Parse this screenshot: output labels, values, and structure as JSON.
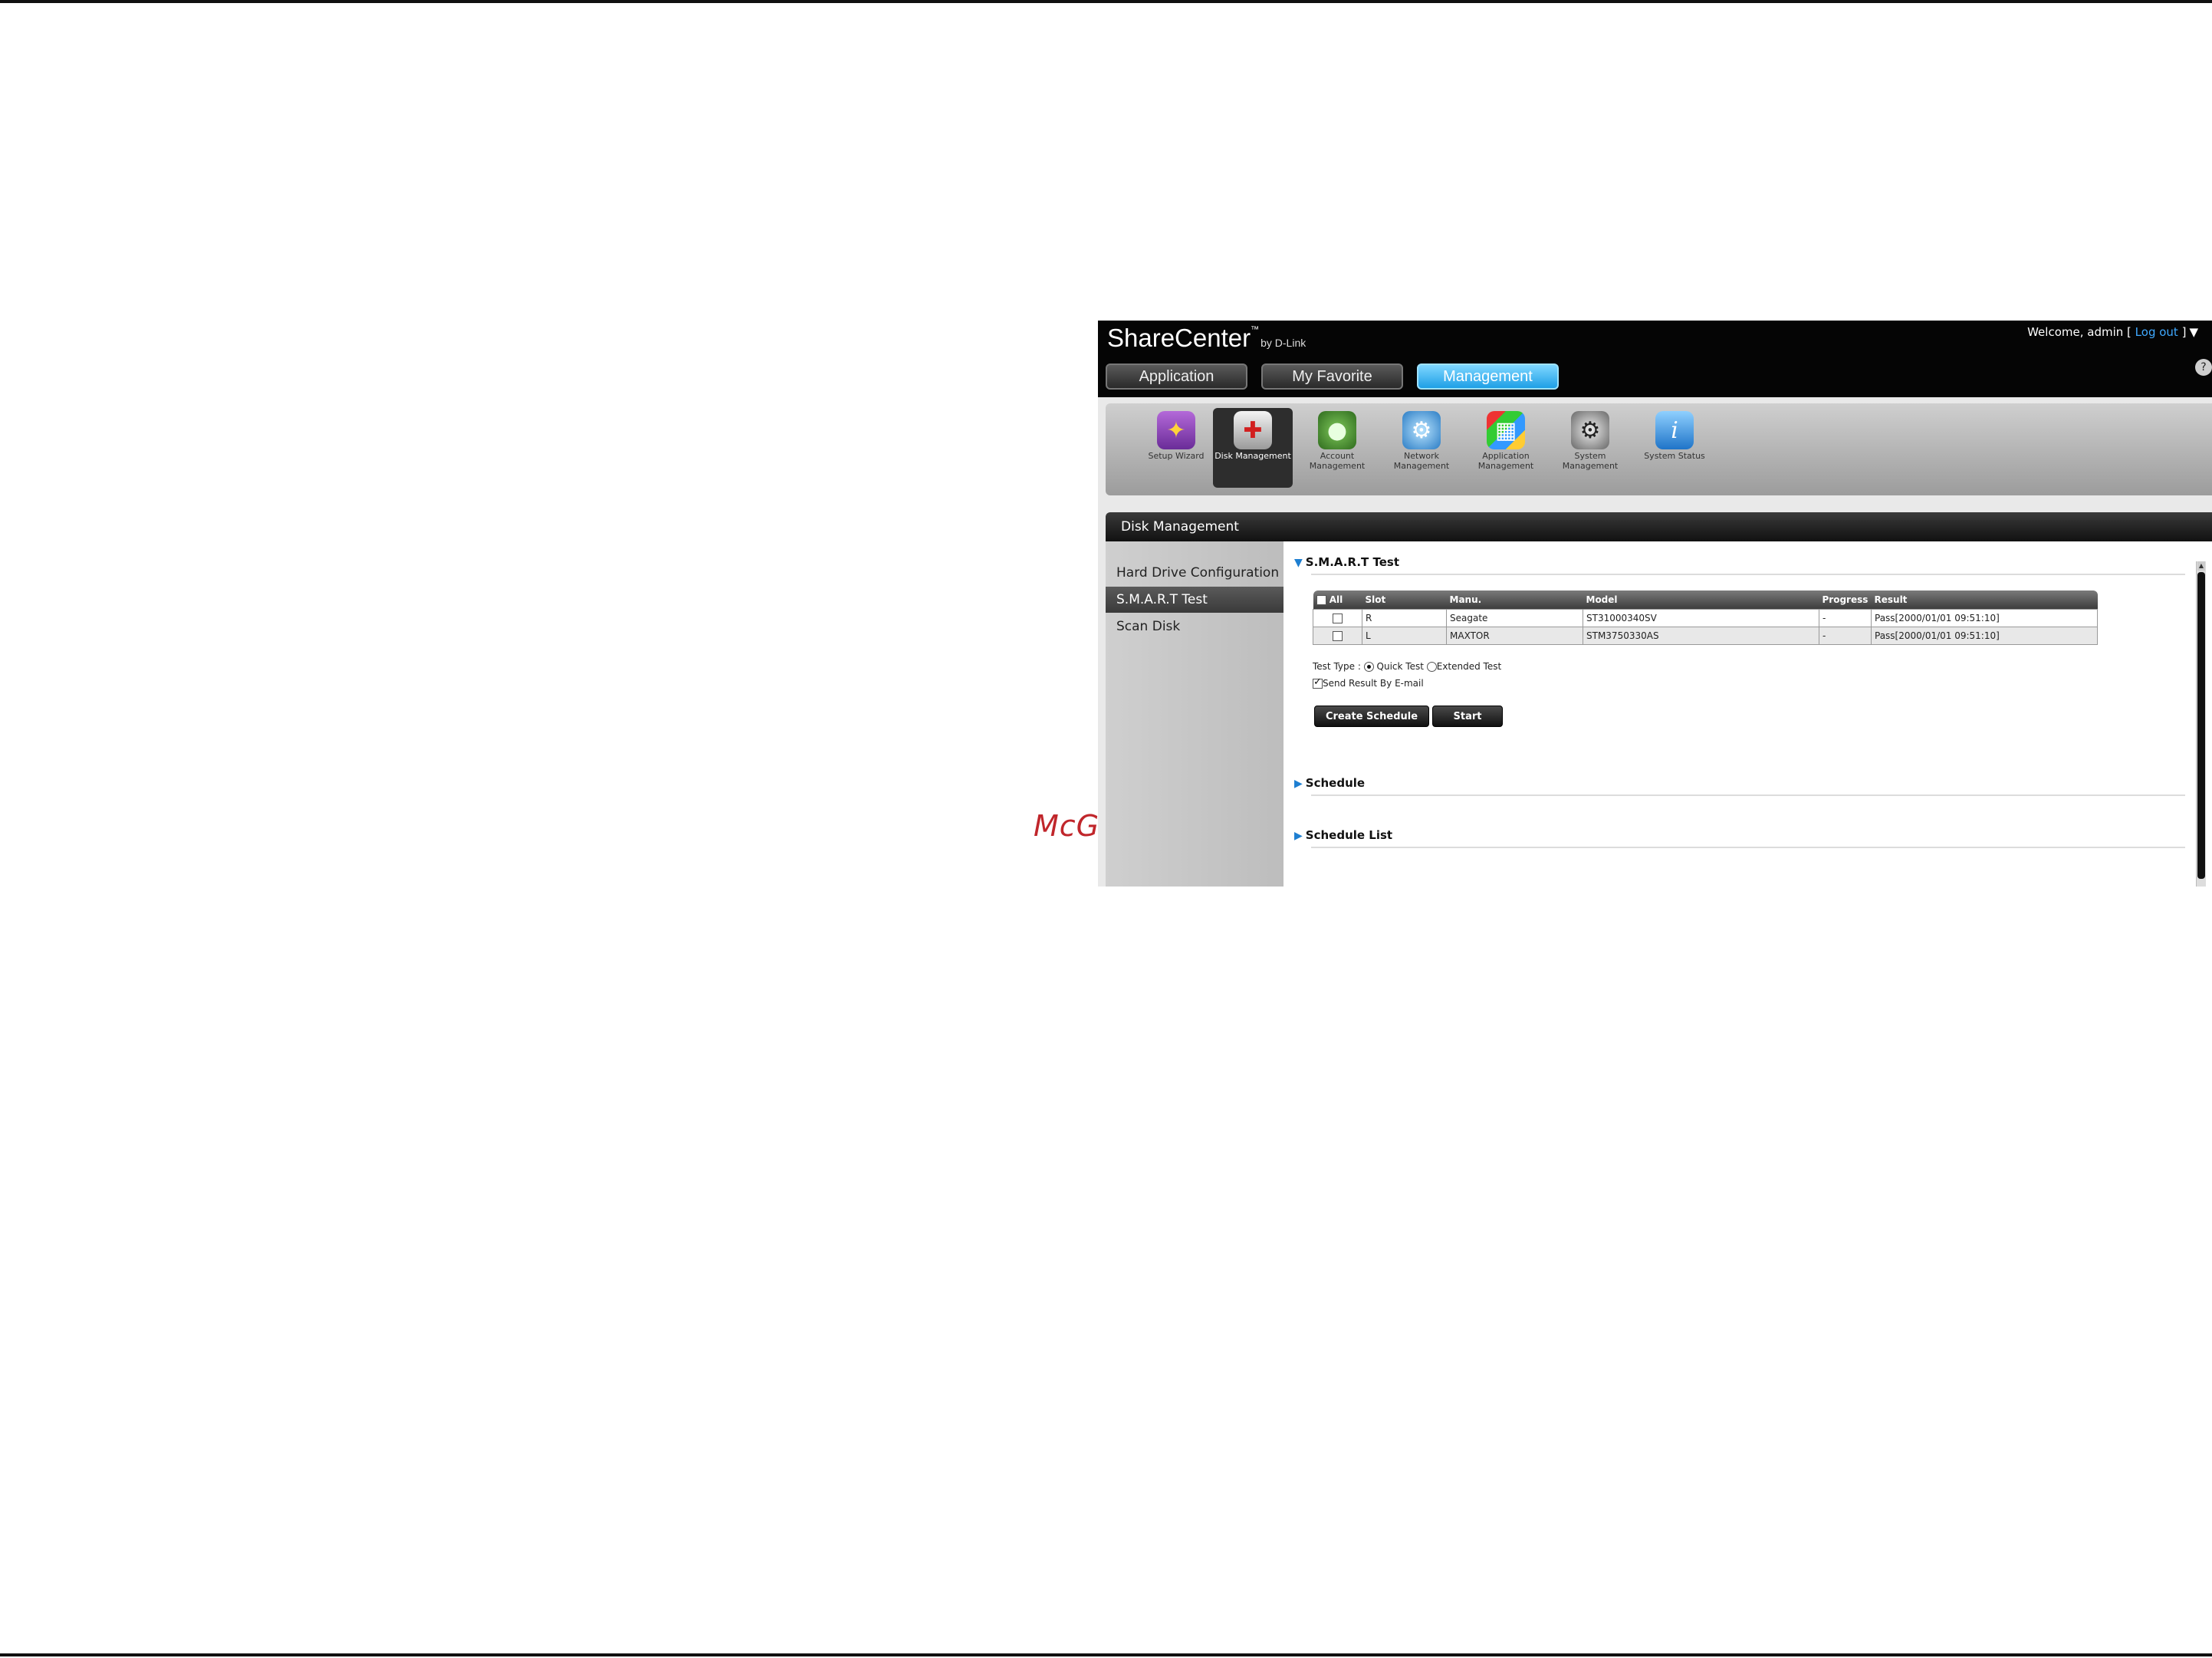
{
  "watermark": "McGrp.Ru",
  "header": {
    "brand": "ShareCenter",
    "brand_tm": "™",
    "brand_by": "by D-Link",
    "welcome_prefix": "Welcome, admin [",
    "logout": "Log out",
    "welcome_suffix": "]",
    "caret": "▼",
    "help": "?"
  },
  "tabs": [
    {
      "label": "Application"
    },
    {
      "label": "My Favorite"
    },
    {
      "label": "Management"
    }
  ],
  "tools": [
    {
      "label": "Setup Wizard",
      "icon": "wizard-icon"
    },
    {
      "label": "Disk Management",
      "icon": "disk-icon"
    },
    {
      "label": "Account Management",
      "icon": "account-icon"
    },
    {
      "label": "Network Management",
      "icon": "network-icon"
    },
    {
      "label": "Application Management",
      "icon": "application-icon"
    },
    {
      "label": "System Management",
      "icon": "system-icon"
    },
    {
      "label": "System Status",
      "icon": "info-icon"
    }
  ],
  "section_title": "Disk Management",
  "sidebar": [
    {
      "label": "Hard Drive Configuration"
    },
    {
      "label": "S.M.A.R.T Test"
    },
    {
      "label": "Scan Disk"
    }
  ],
  "smart": {
    "title": "S.M.A.R.T Test",
    "columns": {
      "all": "All",
      "slot": "Slot",
      "manu": "Manu.",
      "model": "Model",
      "progress": "Progress",
      "result": "Result"
    },
    "rows": [
      {
        "slot": "R",
        "manu": "Seagate",
        "model": "ST31000340SV",
        "progress": "-",
        "result": "Pass[2000/01/01 09:51:10]"
      },
      {
        "slot": "L",
        "manu": "MAXTOR",
        "model": "STM3750330AS",
        "progress": "-",
        "result": "Pass[2000/01/01 09:51:10]"
      }
    ],
    "test_type_label": "Test Type :",
    "quick_test": "Quick Test",
    "extended_test": "Extended Test",
    "send_result": "Send Result By E-mail",
    "create_schedule": "Create Schedule",
    "start": "Start"
  },
  "schedule_title": "Schedule",
  "schedule_list_title": "Schedule List"
}
